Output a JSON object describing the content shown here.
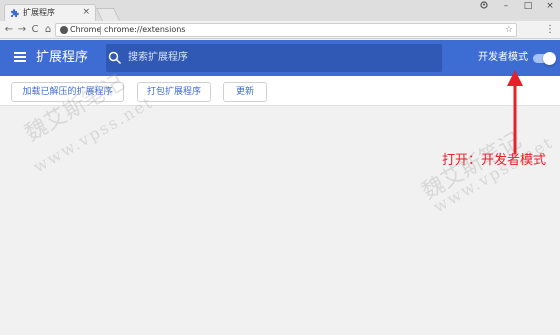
{
  "browser": {
    "tab_title": "扩展程序",
    "tab_close": "×",
    "url_scheme": "Chrome",
    "url_path": "chrome://extensions",
    "window_controls": {
      "minimize": "–",
      "maximize": "□",
      "close": "×"
    },
    "nav": {
      "back": "←",
      "forward": "→",
      "reload": "C",
      "home": "⌂"
    },
    "star": "☆",
    "menu": "⋮"
  },
  "header": {
    "title": "扩展程序",
    "search_placeholder": "搜索扩展程序",
    "dev_mode_label": "开发者模式",
    "dev_mode_on": true,
    "accent_color": "#3d6dd2"
  },
  "actions": {
    "load_unpacked": "加载已解压的扩展程序",
    "pack_extension": "打包扩展程序",
    "update": "更新"
  },
  "annotation": {
    "text": "打开：开发者模式",
    "color": "#e8202a"
  },
  "watermark": {
    "name": "魏艾斯笔记",
    "site": "www.vpss.net"
  }
}
